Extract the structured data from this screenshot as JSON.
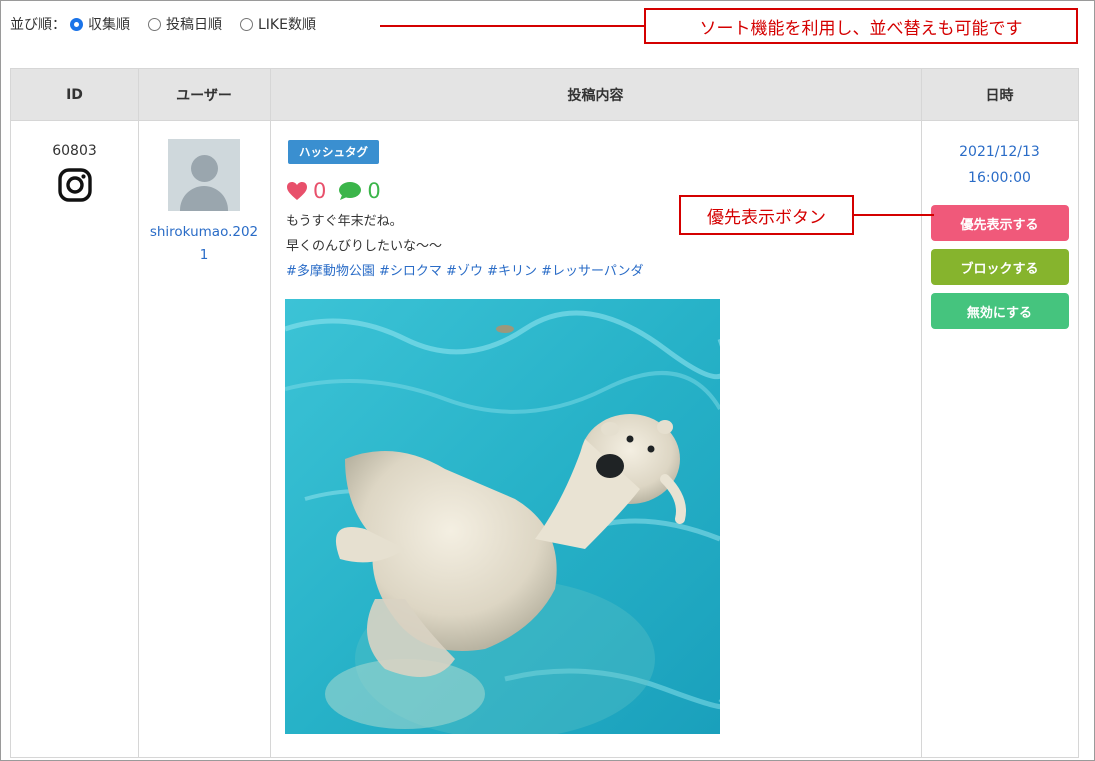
{
  "sort": {
    "label": "並び順：",
    "options": [
      {
        "label": "収集順",
        "selected": true
      },
      {
        "label": "投稿日順",
        "selected": false
      },
      {
        "label": "LIKE数順",
        "selected": false
      }
    ]
  },
  "annotations": {
    "sort_note": "ソート機能を利用し、並べ替えも可能です",
    "priority_note": "優先表示ボタン",
    "color": "#d40000"
  },
  "table": {
    "headers": [
      "ID",
      "ユーザー",
      "投稿内容",
      "日時"
    ]
  },
  "post": {
    "id": "60803",
    "source_icon": "instagram-icon",
    "user": "shirokumao.2021",
    "badge": "ハッシュタグ",
    "likes": "0",
    "comments": "0",
    "lines": [
      "もうすぐ年末だね。",
      "早くのんびりしたいな〜〜"
    ],
    "hashtags": "#多摩動物公園 #シロクマ #ゾウ #キリン #レッサーパンダ",
    "image": "polar-bear-swimming-photo",
    "date": "2021/12/13",
    "time": "16:00:00"
  },
  "actions": {
    "priority": "優先表示する",
    "block": "ブロックする",
    "disable": "無効にする"
  },
  "colors": {
    "header_bg": "#e4e4e4",
    "link": "#2a6cc7",
    "badge": "#3a8fd0",
    "like": "#e8506b",
    "comment": "#3bb54a",
    "priority_btn": "#f0597a",
    "block_btn": "#86b42d",
    "disable_btn": "#45c47e"
  }
}
